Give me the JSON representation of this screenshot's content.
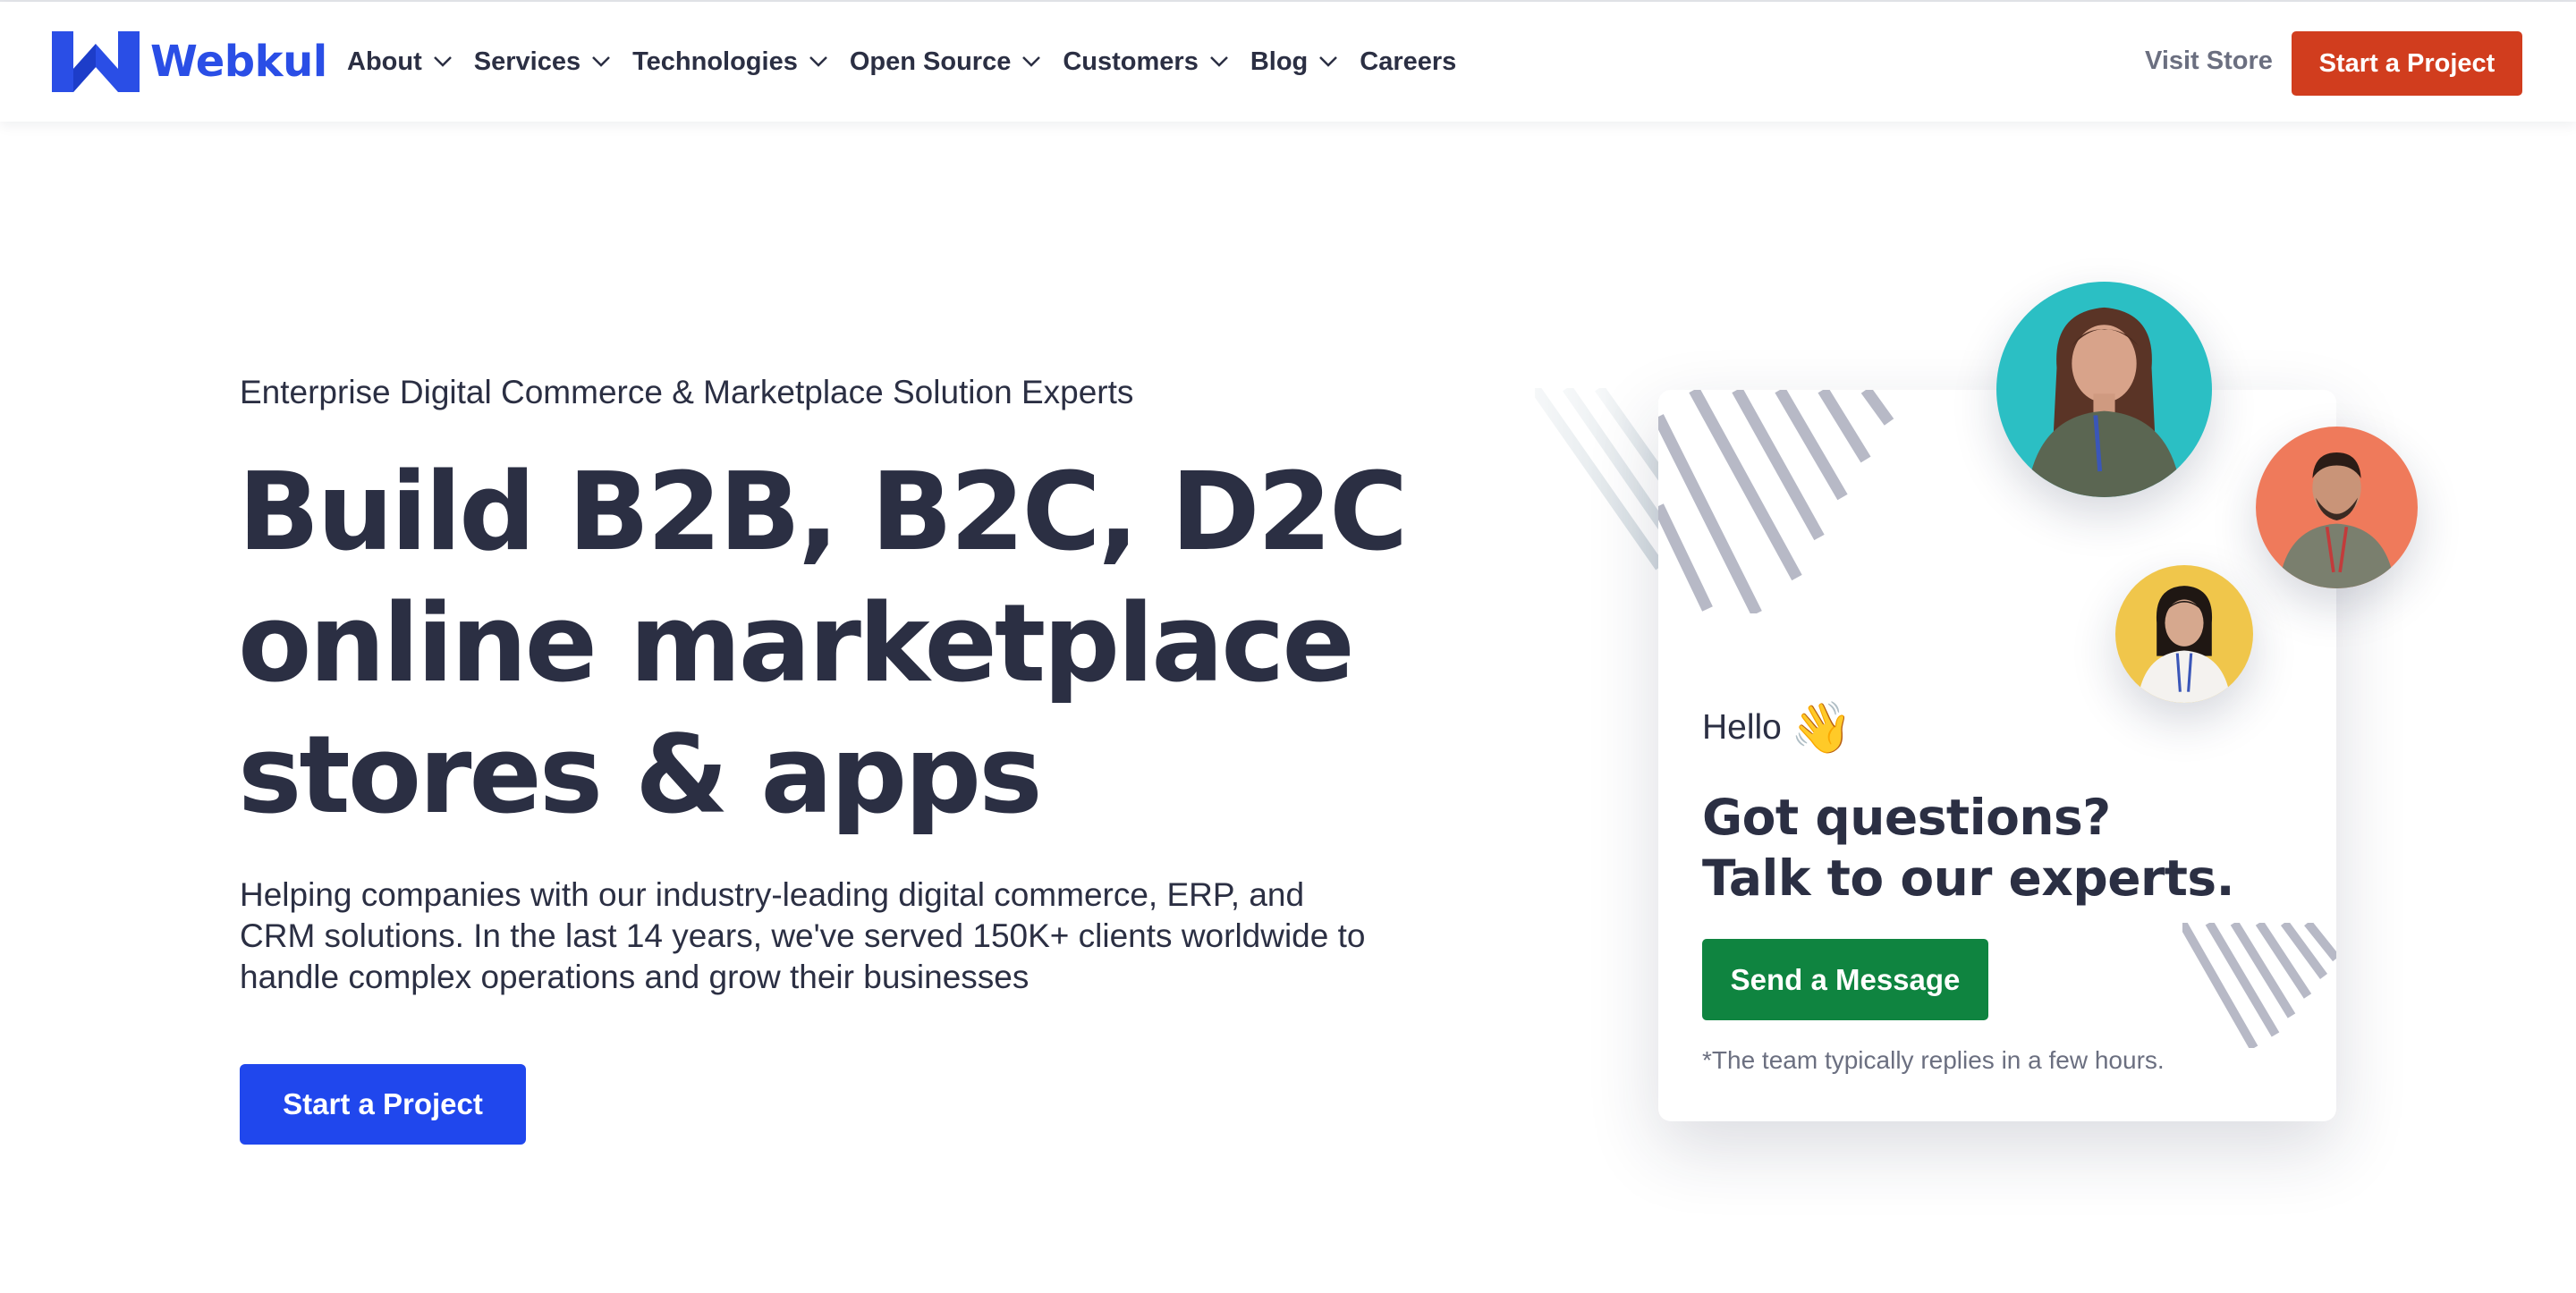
{
  "brand": {
    "name": "Webkul",
    "color": "#2a4ee6"
  },
  "nav": {
    "items": [
      {
        "label": "About",
        "has_dropdown": true
      },
      {
        "label": "Services",
        "has_dropdown": true
      },
      {
        "label": "Technologies",
        "has_dropdown": true
      },
      {
        "label": "Open Source",
        "has_dropdown": true
      },
      {
        "label": "Customers",
        "has_dropdown": true
      },
      {
        "label": "Blog",
        "has_dropdown": true
      },
      {
        "label": "Careers",
        "has_dropdown": false
      }
    ],
    "visit_store": "Visit Store",
    "start_project": "Start a Project",
    "start_project_color": "#d13d1e"
  },
  "hero": {
    "subtitle": "Enterprise Digital Commerce & Marketplace Solution Experts",
    "title_lines": [
      "Build B2B, B2C, D2C",
      "online marketplace",
      "stores & apps"
    ],
    "description": "Helping companies with our industry-leading digital commerce, ERP, and CRM solutions. In the last 14 years, we've served 150K+ clients worldwide to handle complex operations and grow their businesses",
    "cta": "Start a Project",
    "cta_color": "#2047ed"
  },
  "contact_card": {
    "greeting": "Hello",
    "wave_emoji": "👋",
    "title_lines": [
      "Got questions?",
      "Talk to our experts."
    ],
    "button": "Send a Message",
    "button_color": "#0f8440",
    "note": "*The team typically replies in a few hours.",
    "avatars": [
      {
        "icon": "support-agent-woman-avatar",
        "bg": "#2bbfc4"
      },
      {
        "icon": "support-agent-man-avatar",
        "bg": "#ef7a5b"
      },
      {
        "icon": "support-agent-woman-avatar",
        "bg": "#f0c64b"
      }
    ]
  }
}
